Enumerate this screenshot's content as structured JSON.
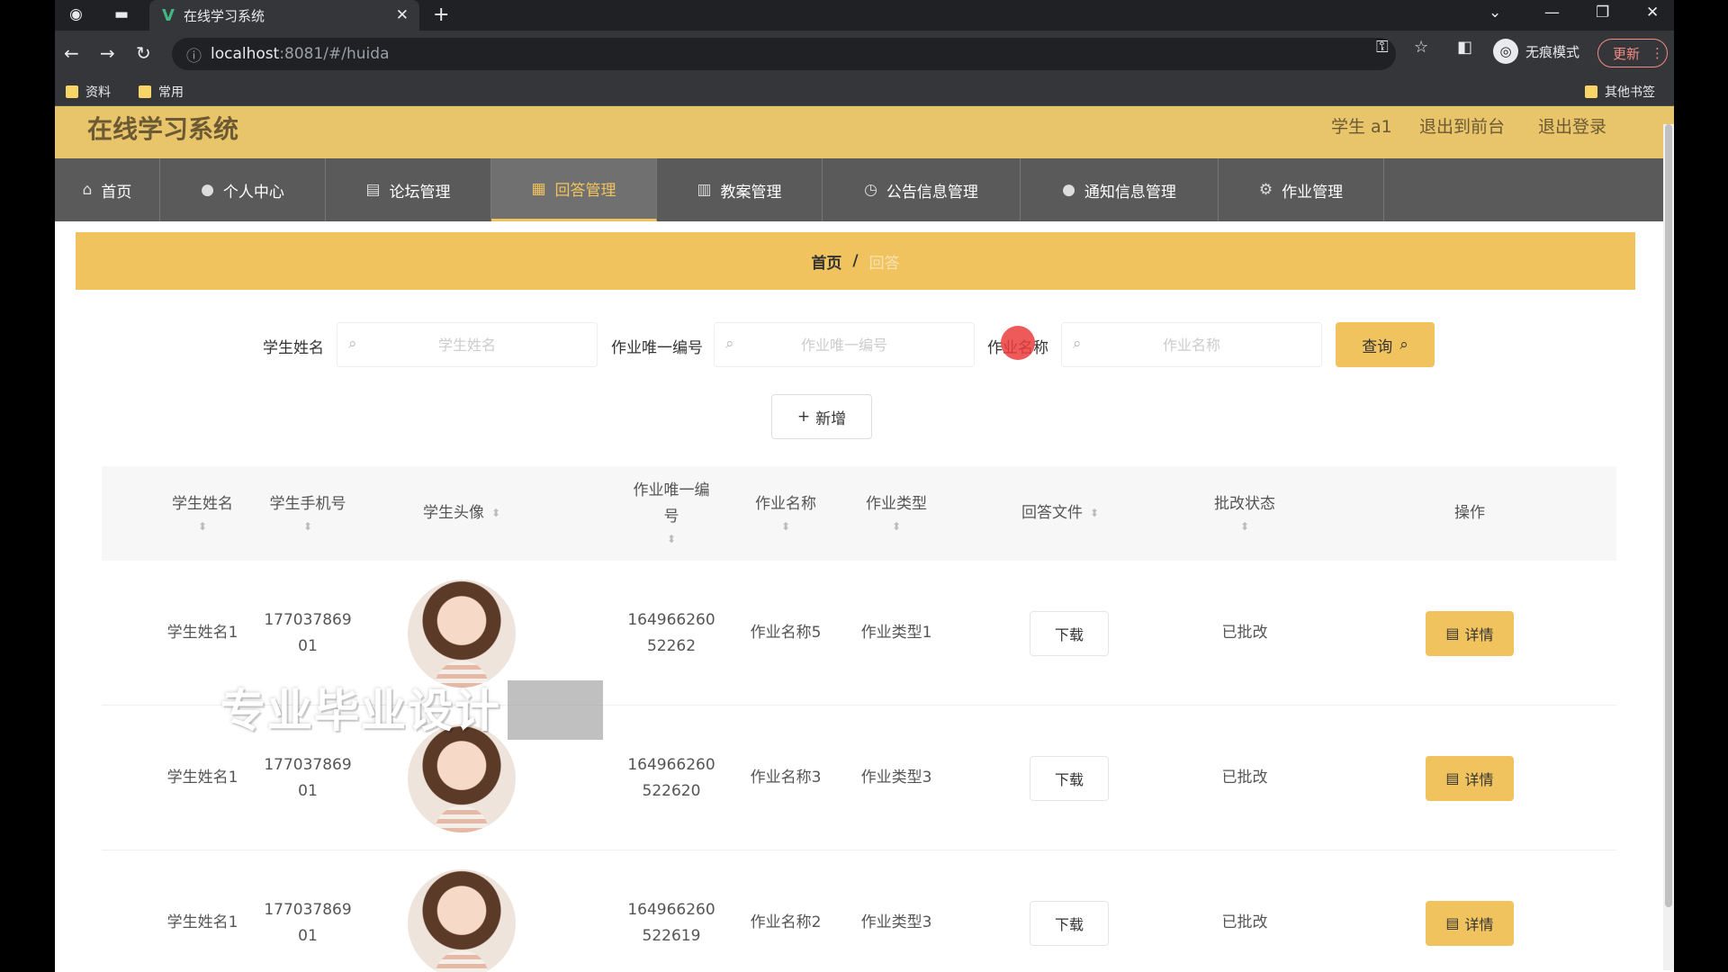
{
  "browser": {
    "tab_title": "在线学习系统",
    "new_tab": "+",
    "url_host": "localhost",
    "url_path": ":8081/#/huida",
    "incognito_label": "无痕模式",
    "update_label": "更新",
    "bookmarks": [
      "资料",
      "常用"
    ],
    "other_bookmarks": "其他书签"
  },
  "app": {
    "title": "在线学习系统",
    "user_label": "学生 a1",
    "back_front": "退出到前台",
    "logout": "退出登录"
  },
  "nav": [
    {
      "label": "首页",
      "icon": "home-icon"
    },
    {
      "label": "个人中心",
      "icon": "user-icon"
    },
    {
      "label": "论坛管理",
      "icon": "forum-icon"
    },
    {
      "label": "回答管理",
      "icon": "answer-icon",
      "active": true
    },
    {
      "label": "教案管理",
      "icon": "book-icon"
    },
    {
      "label": "公告信息管理",
      "icon": "clock-icon"
    },
    {
      "label": "通知信息管理",
      "icon": "notice-icon"
    },
    {
      "label": "作业管理",
      "icon": "gear-icon"
    }
  ],
  "breadcrumb": {
    "home": "首页",
    "sep": "/",
    "current": "回答"
  },
  "search": {
    "student_name_label": "学生姓名",
    "student_name_placeholder": "学生姓名",
    "hw_id_label": "作业唯一编号",
    "hw_id_placeholder": "作业唯一编号",
    "hw_name_label": "作业名称",
    "hw_name_placeholder": "作业名称",
    "query_label": "查询"
  },
  "add_label": "新增",
  "table": {
    "headers": [
      "学生姓名",
      "学生手机号",
      "学生头像",
      "作业唯一编号",
      "作业名称",
      "作业类型",
      "回答文件",
      "批改状态",
      "操作"
    ],
    "rows": [
      {
        "name": "学生姓名1",
        "phone": "177037869 01",
        "hw_id": "164966260 52262",
        "hw_name": "作业名称5",
        "hw_type": "作业类型1",
        "file": "下载",
        "status": "已批改",
        "action": "详情"
      },
      {
        "name": "学生姓名1",
        "phone": "177037869 01",
        "hw_id": "164966260 522620",
        "hw_name": "作业名称3",
        "hw_type": "作业类型3",
        "file": "下载",
        "status": "已批改",
        "action": "详情"
      },
      {
        "name": "学生姓名1",
        "phone": "177037869 01",
        "hw_id": "164966260 522619",
        "hw_name": "作业名称2",
        "hw_type": "作业类型3",
        "file": "下载",
        "status": "已批改",
        "action": "详情"
      }
    ]
  },
  "watermark": "专业毕业设计",
  "colors": {
    "accent": "#f0c35e",
    "header": "#e8c46b",
    "nav": "#5a5a5a"
  }
}
